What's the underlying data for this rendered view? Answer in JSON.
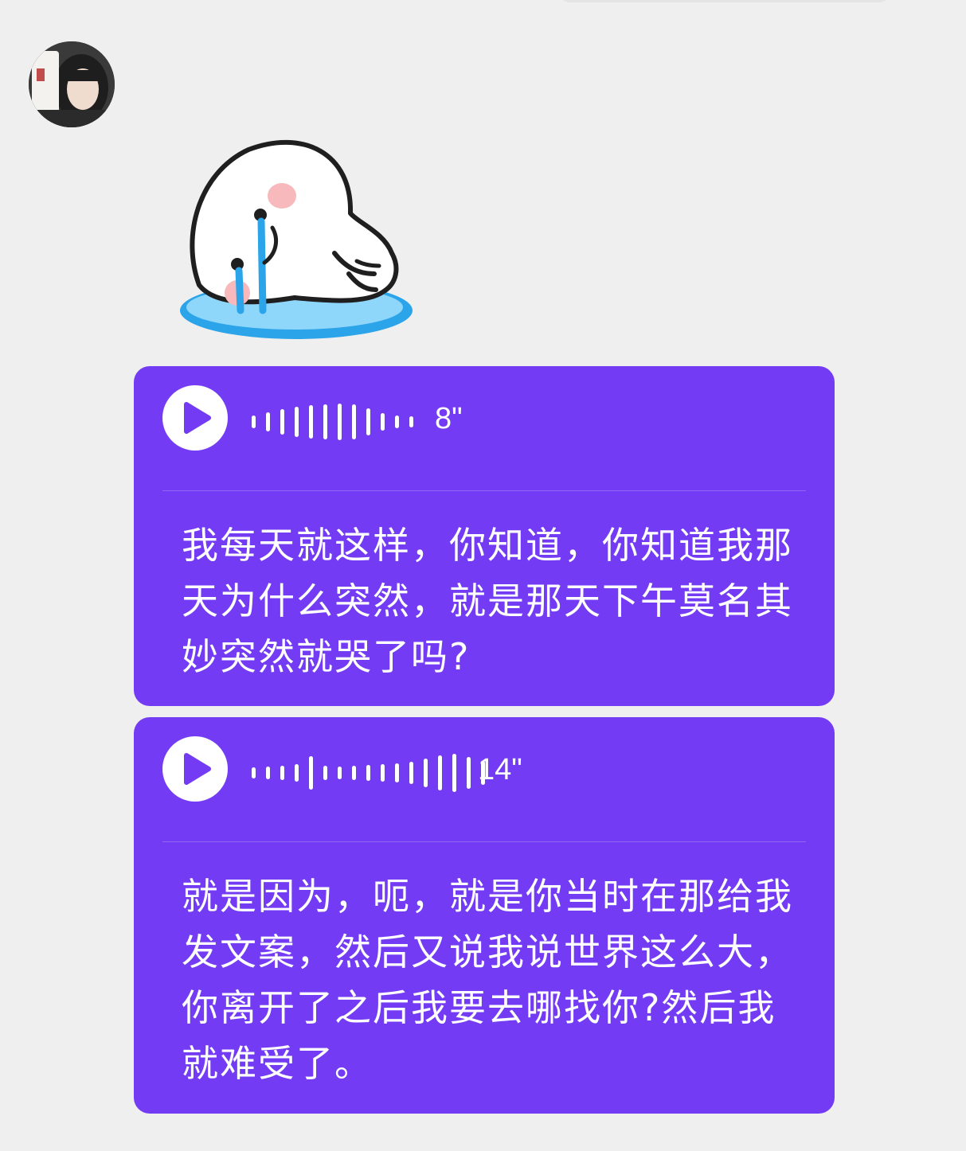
{
  "chat": {
    "messages": [
      {
        "type": "voice",
        "duration": "8\"",
        "waveform": [
          16,
          24,
          32,
          38,
          42,
          44,
          46,
          44,
          34,
          22,
          16,
          14
        ],
        "transcript": "我每天就这样，你知道，你知道我那天为什么突然，就是那天下午莫名其妙突然就哭了吗?"
      },
      {
        "type": "voice",
        "duration": "14\"",
        "waveform": [
          14,
          16,
          18,
          22,
          42,
          18,
          16,
          18,
          20,
          22,
          24,
          28,
          36,
          44,
          48,
          40,
          30
        ],
        "transcript": "就是因为，呃，就是你当时在那给我发文案，然后又说我说世界这么大，你离开了之后我要去哪找你?然后我就难受了。"
      }
    ]
  },
  "colors": {
    "background": "#efefef",
    "bubble": "#733cf4",
    "text": "#ffffff"
  },
  "icons": {
    "play": "play-icon",
    "sticker": "crying-sticker"
  }
}
